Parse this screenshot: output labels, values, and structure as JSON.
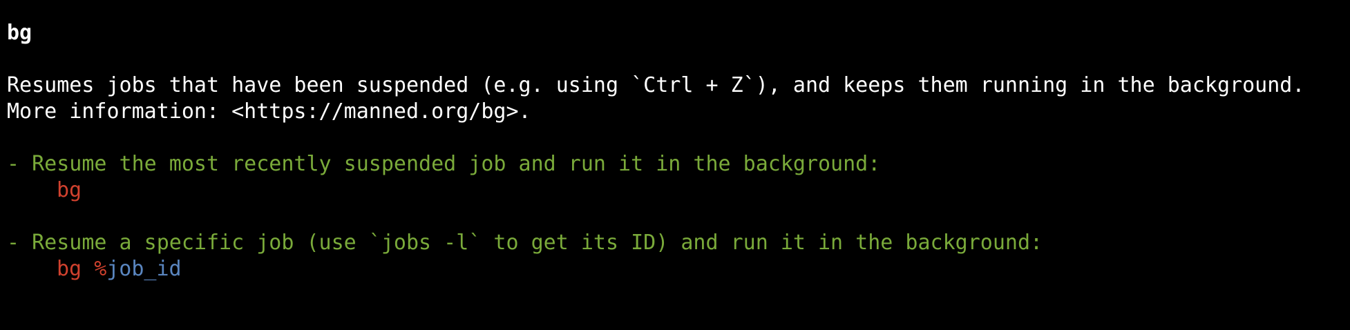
{
  "page": {
    "title": "bg",
    "description_line1": "Resumes jobs that have been suspended (e.g. using `Ctrl + Z`), and keeps them running in the background.",
    "description_line2": "More information: <https://manned.org/bg>."
  },
  "examples": [
    {
      "description": "- Resume the most recently suspended job and run it in the background:",
      "command": "bg"
    },
    {
      "description": "- Resume a specific job (use `jobs -l` to get its ID) and run it in the background:",
      "command": "bg",
      "command_sep": " ",
      "param_prefix": "%",
      "param": "job_id"
    }
  ],
  "colors": {
    "background": "#000000",
    "text": "#ffffff",
    "example_description": "#7aaa3a",
    "command": "#d0412e",
    "parameter": "#5a86c0"
  }
}
